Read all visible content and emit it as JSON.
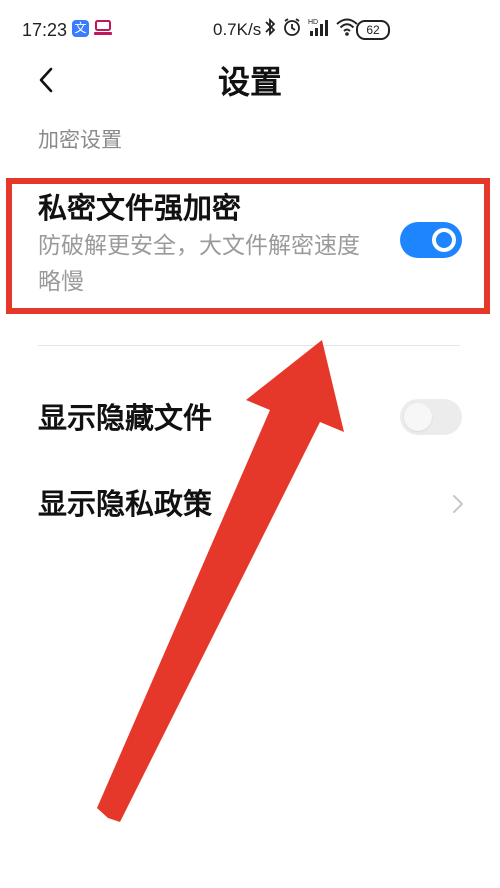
{
  "status_bar": {
    "time": "17:23",
    "app_icon_1": "文",
    "net_speed": "0.7K/s",
    "icons": [
      "bluetooth-icon",
      "alarm-icon",
      "hd-signal-icon",
      "wifi-icon"
    ],
    "battery": "62"
  },
  "header": {
    "back_icon": "chevron-left-icon",
    "title": "设置"
  },
  "section": {
    "title": "加密设置"
  },
  "settings": {
    "strong_encryption": {
      "title": "私密文件强加密",
      "description": "防破解更安全，大文件解密速度略慢",
      "enabled": true
    },
    "show_hidden_files": {
      "title": "显示隐藏文件",
      "enabled": false
    },
    "privacy_policy": {
      "title": "显示隐私政策",
      "icon": "chevron-right-icon"
    }
  },
  "colors": {
    "accent": "#1f85ff",
    "annotation": "#e5382a",
    "toggle_off": "#ececec"
  }
}
